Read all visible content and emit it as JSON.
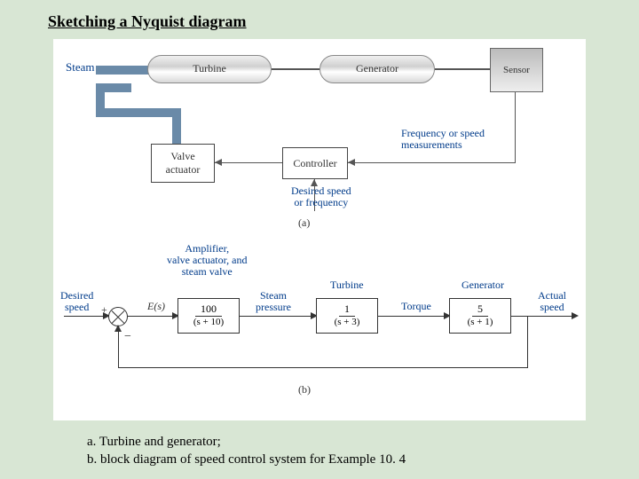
{
  "title": "Sketching a Nyquist diagram",
  "diagram_a": {
    "steam": "Steam",
    "turbine": "Turbine",
    "generator": "Generator",
    "sensor": "Sensor",
    "valve_actuator": "Valve\nactuator",
    "controller": "Controller",
    "freq_meas": "Frequency or speed\nmeasurements",
    "desired": "Desired speed\nor frequency",
    "sublabel": "(a)"
  },
  "diagram_b": {
    "amp_label": "Amplifier,\nvalve actuator, and\nsteam valve",
    "desired_speed": "Desired\nspeed",
    "e_s": "E(s)",
    "plus": "+",
    "minus": "−",
    "steam_pressure": "Steam\npressure",
    "turbine": "Turbine",
    "torque": "Torque",
    "generator": "Generator",
    "actual_speed": "Actual\nspeed",
    "tf1_num": "100",
    "tf1_den": "(s + 10)",
    "tf2_num": "1",
    "tf2_den": "(s + 3)",
    "tf3_num": "5",
    "tf3_den": "(s + 1)",
    "sublabel": "(b)"
  },
  "caption_a": "a. Turbine and generator;",
  "caption_b": "b. block diagram of speed control system for Example 10. 4",
  "chart_data": {
    "type": "diagram",
    "panels": [
      {
        "id": "a",
        "description": "Physical schematic of turbine-generator speed control",
        "blocks": [
          "Steam",
          "Turbine",
          "Generator",
          "Sensor",
          "Valve actuator",
          "Controller"
        ],
        "signals": [
          "Frequency or speed measurements",
          "Desired speed or frequency"
        ],
        "connections": [
          [
            "Steam",
            "Turbine"
          ],
          [
            "Turbine",
            "Generator"
          ],
          [
            "Generator",
            "Sensor"
          ],
          [
            "Sensor",
            "Controller",
            "Frequency or speed measurements"
          ],
          [
            "Desired speed or frequency",
            "Controller"
          ],
          [
            "Controller",
            "Valve actuator"
          ],
          [
            "Valve actuator",
            "Steam"
          ]
        ]
      },
      {
        "id": "b",
        "description": "Block diagram of speed control system",
        "input": "Desired speed",
        "output": "Actual speed",
        "error": "E(s)",
        "forward_path": [
          {
            "label": "Amplifier, valve actuator, and steam valve",
            "tf": "100/(s+10)",
            "output_signal": "Steam pressure"
          },
          {
            "label": "Turbine",
            "tf": "1/(s+3)",
            "output_signal": "Torque"
          },
          {
            "label": "Generator",
            "tf": "5/(s+1)",
            "output_signal": "Actual speed"
          }
        ],
        "feedback": "unity negative"
      }
    ]
  }
}
